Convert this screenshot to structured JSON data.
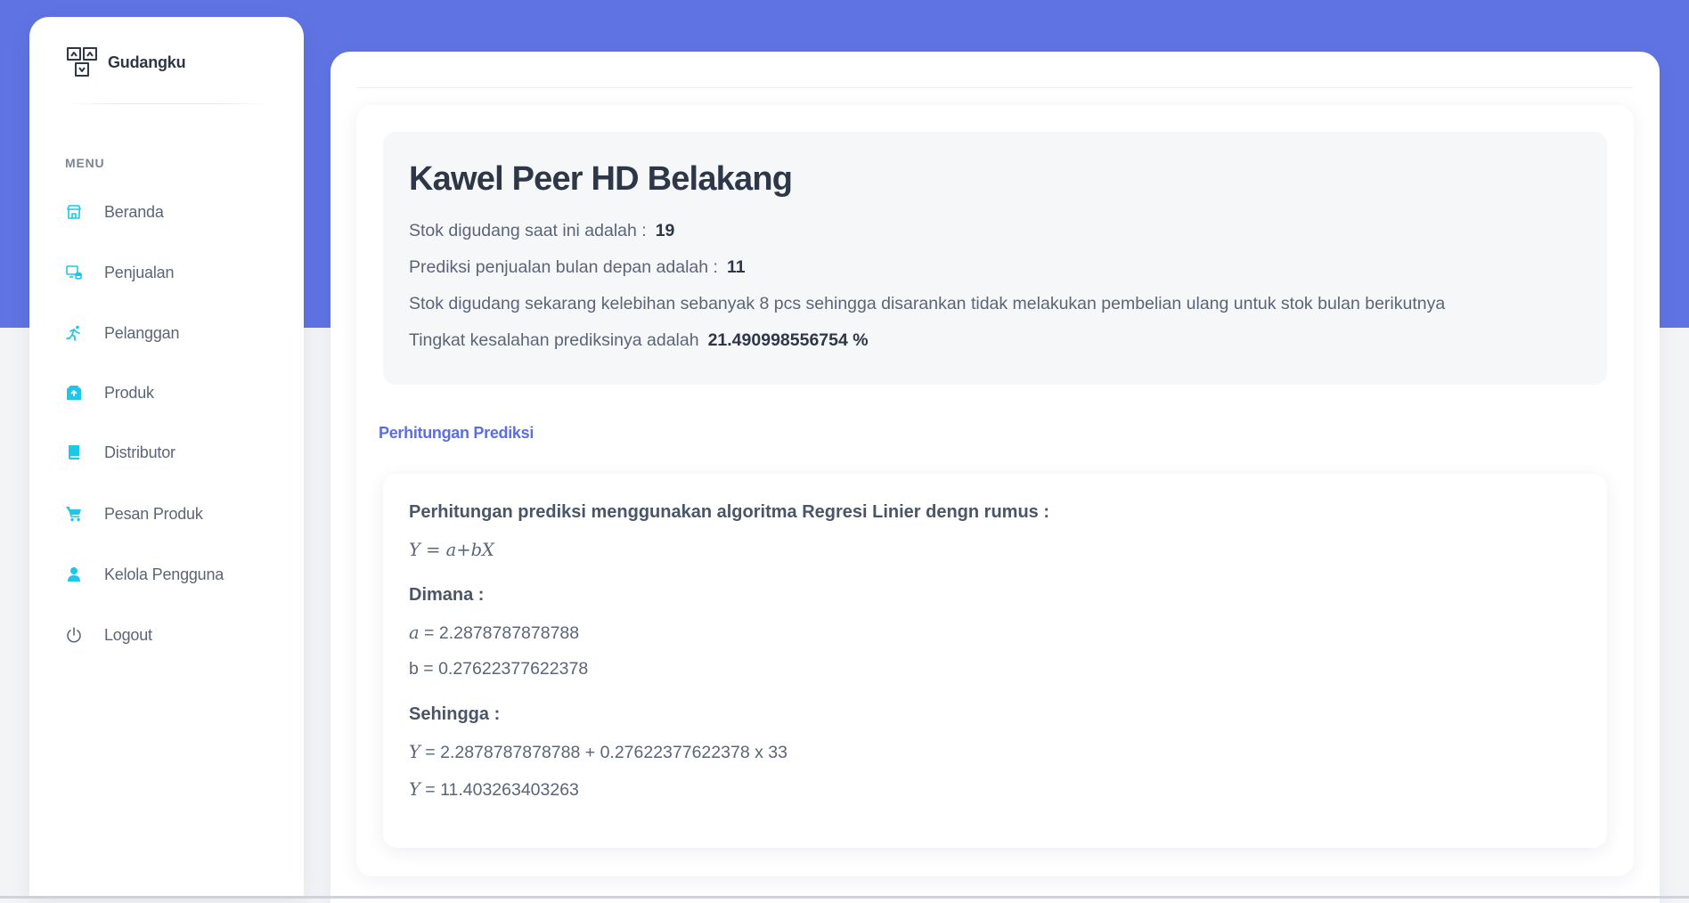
{
  "brand": {
    "name": "Gudangku",
    "logo_icon": "warehouse-box-icon"
  },
  "sidebar": {
    "heading": "MENU",
    "items": [
      {
        "label": "Beranda",
        "icon": "store-icon"
      },
      {
        "label": "Penjualan",
        "icon": "sales-icon"
      },
      {
        "label": "Pelanggan",
        "icon": "running-person-icon"
      },
      {
        "label": "Produk",
        "icon": "package-icon"
      },
      {
        "label": "Distributor",
        "icon": "book-icon"
      },
      {
        "label": "Pesan Produk",
        "icon": "cart-icon"
      },
      {
        "label": "Kelola Pengguna",
        "icon": "user-icon"
      },
      {
        "label": "Logout",
        "icon": "power-icon"
      }
    ]
  },
  "product": {
    "title": "Kawel Peer HD Belakang",
    "stock_label": "Stok digudang saat ini adalah :",
    "stock_value": "19",
    "prediction_label": "Prediksi penjualan bulan depan adalah :",
    "prediction_value": "11",
    "recommendation": "Stok digudang sekarang kelebihan sebanyak 8 pcs sehingga disarankan tidak melakukan pembelian ulang untuk stok bulan berikutnya",
    "error_label": "Tingkat kesalahan prediksinya adalah",
    "error_value": "21.490998556754 %"
  },
  "section_link": "Perhitungan Prediksi",
  "calculation": {
    "intro": "Perhitungan prediksi menggunakan algoritma Regresi Linier dengn rumus :",
    "formula": "Y = a+bX",
    "where_heading": "Dimana :",
    "a_var": "a",
    "a_value": " = 2.2878787878788",
    "b_line": "b = 0.27622377622378",
    "so_heading": "Sehingga :",
    "y_var": "Y",
    "y_expression": " = 2.2878787878788 + 0.27622377622378 x 33",
    "y_result": " = 11.403263403263"
  },
  "colors": {
    "accent": "#5f74e2",
    "link": "#5b6fe0",
    "nav_icon": "#1cc7e8",
    "background": "#f3f4f6"
  }
}
